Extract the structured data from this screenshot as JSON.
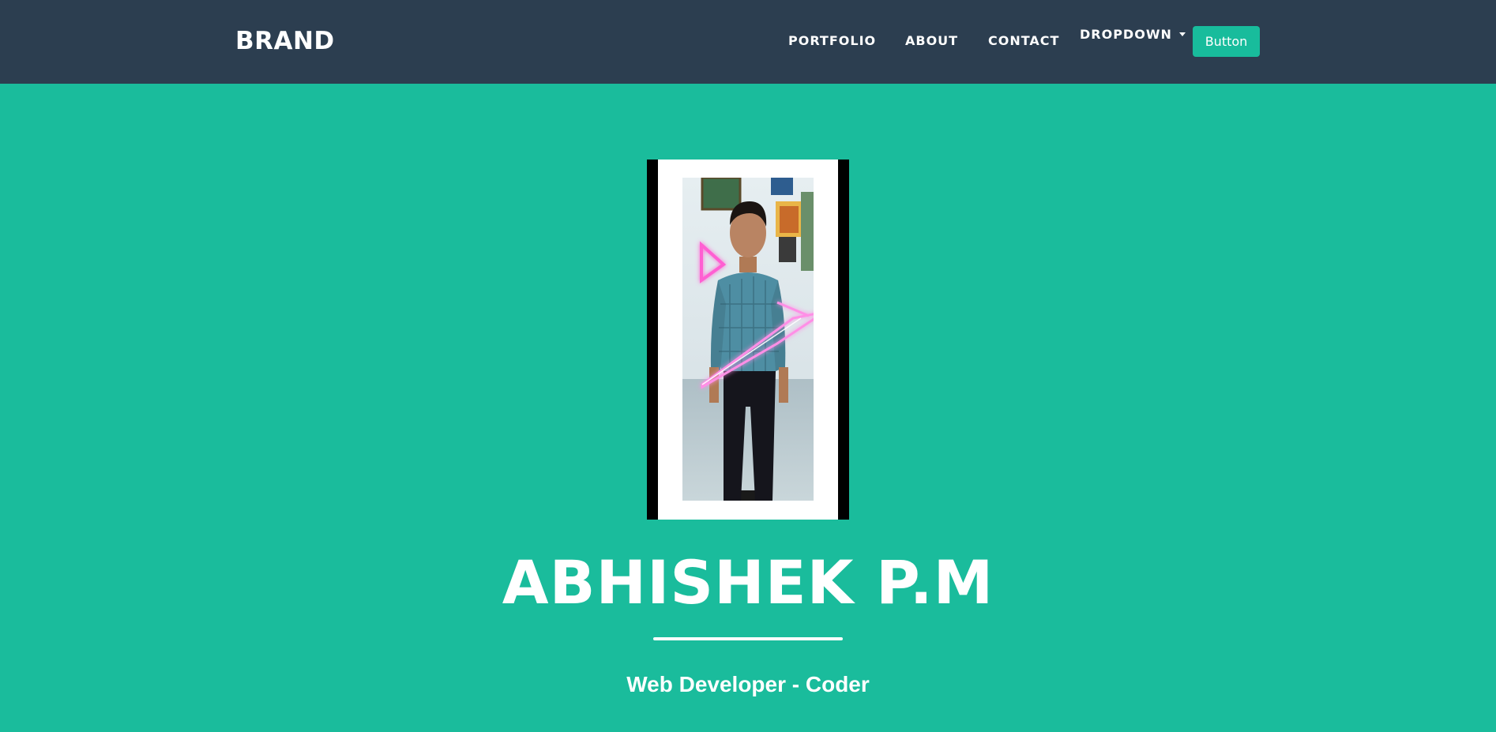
{
  "navbar": {
    "brand": "BRAND",
    "links": [
      {
        "label": "PORTFOLIO"
      },
      {
        "label": "ABOUT"
      },
      {
        "label": "CONTACT"
      }
    ],
    "dropdown_label": "DROPDOWN",
    "button_label": "Button"
  },
  "hero": {
    "name": "ABHISHEK P.M",
    "tagline": "Web Developer - Coder"
  },
  "colors": {
    "navbar_bg": "#2c3e50",
    "hero_bg": "#1abc9c",
    "button_bg": "#18bc9c",
    "text": "#ffffff"
  },
  "icons": {
    "dropdown": "caret-down-icon"
  }
}
